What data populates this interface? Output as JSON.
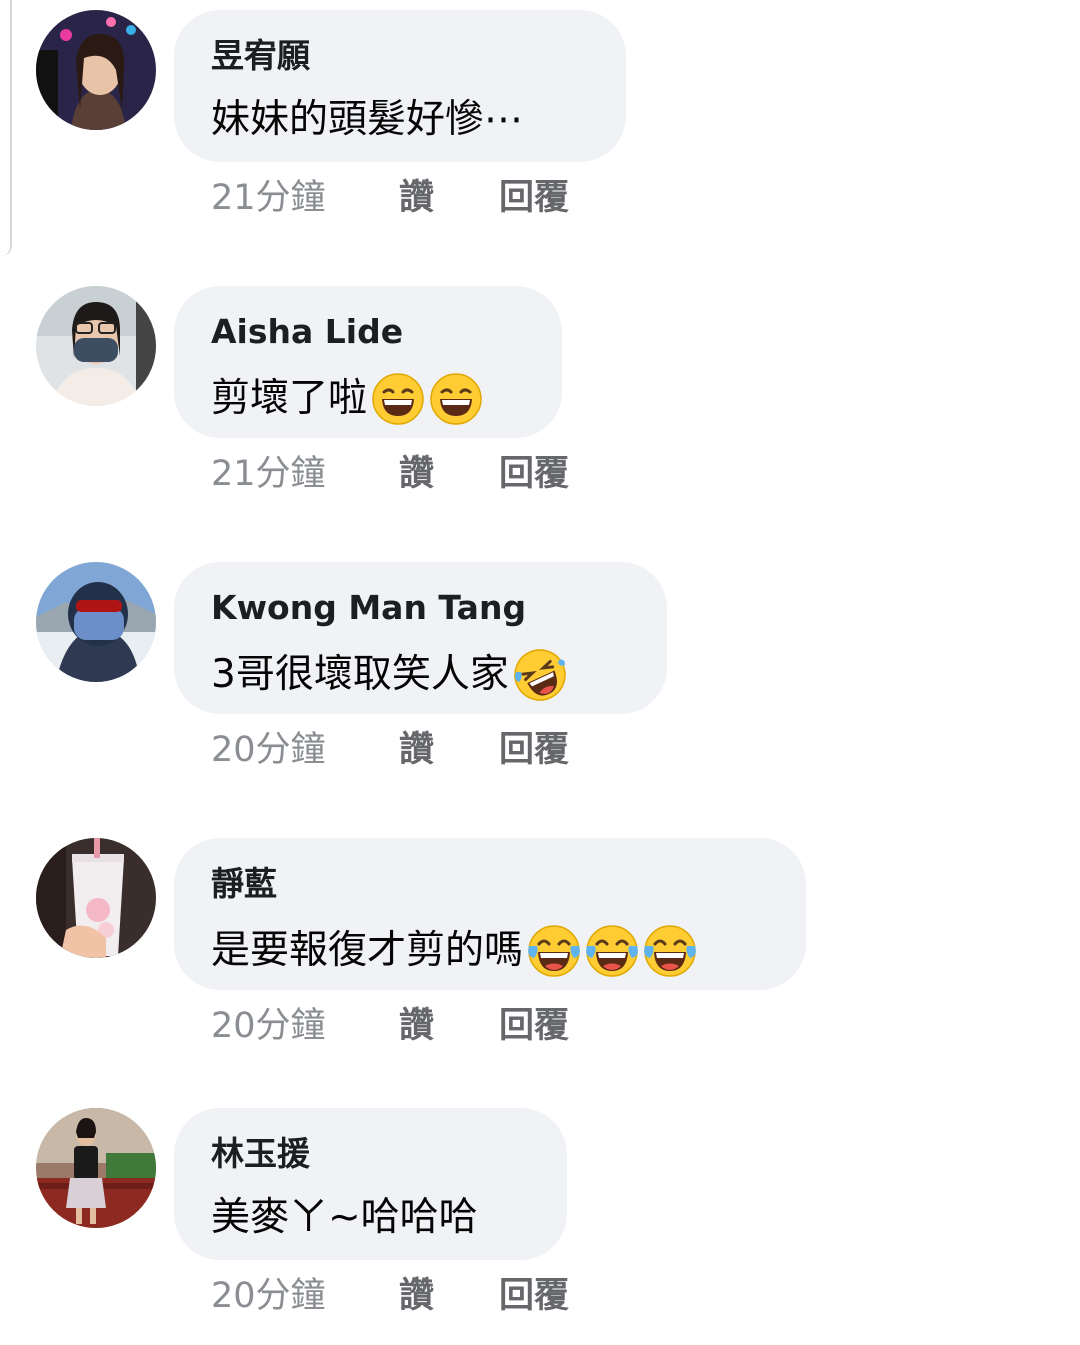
{
  "comments": [
    {
      "author": "昱宥願",
      "text": "妹妹的頭髮好慘⋯",
      "emojis": [],
      "time": "21分鐘",
      "like_label": "讚",
      "reply_label": "回覆"
    },
    {
      "author": "Aisha Lide",
      "text": "剪壞了啦",
      "emojis": [
        "grinning-squinting-emoji",
        "grinning-squinting-emoji"
      ],
      "time": "21分鐘",
      "like_label": "讚",
      "reply_label": "回覆"
    },
    {
      "author": "Kwong Man Tang",
      "text": "3哥很壞取笑人家",
      "emojis": [
        "rolling-laughing-emoji"
      ],
      "time": "20分鐘",
      "like_label": "讚",
      "reply_label": "回覆"
    },
    {
      "author": "靜藍",
      "text": "是要報復才剪的嗎",
      "emojis": [
        "tears-of-joy-emoji",
        "tears-of-joy-emoji",
        "tears-of-joy-emoji"
      ],
      "time": "20分鐘",
      "like_label": "讚",
      "reply_label": "回覆"
    },
    {
      "author": "林玉援",
      "text": "美麥ㄚ~哈哈哈",
      "emojis": [],
      "time": "20分鐘",
      "like_label": "讚",
      "reply_label": "回覆"
    }
  ],
  "colors": {
    "bubble_bg": "#f0f2f5",
    "meta_text": "#8a8d91",
    "author_text": "#1c1e21"
  }
}
